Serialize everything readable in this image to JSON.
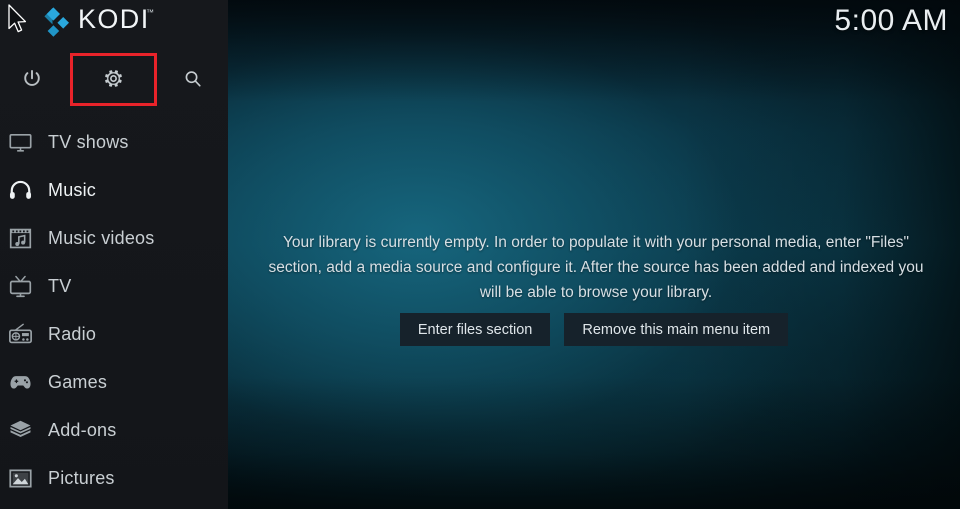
{
  "app": {
    "name": "Kodi",
    "logo_text": "KODI",
    "logo_tm": "™"
  },
  "header": {
    "clock": "5:00 AM"
  },
  "sidebar": {
    "top_actions": [
      {
        "name": "power",
        "icon": "power-icon",
        "highlighted": false
      },
      {
        "name": "settings",
        "icon": "gear-icon",
        "highlighted": true
      },
      {
        "name": "search",
        "icon": "search-icon",
        "highlighted": false
      }
    ],
    "highlight_color": "#e8232a",
    "items": [
      {
        "label": "TV shows",
        "icon": "tv-monitor-icon",
        "selected": false
      },
      {
        "label": "Music",
        "icon": "headphones-icon",
        "selected": true
      },
      {
        "label": "Music videos",
        "icon": "film-note-icon",
        "selected": false
      },
      {
        "label": "TV",
        "icon": "tv-antenna-icon",
        "selected": false
      },
      {
        "label": "Radio",
        "icon": "radio-icon",
        "selected": false
      },
      {
        "label": "Games",
        "icon": "gamepad-icon",
        "selected": false
      },
      {
        "label": "Add-ons",
        "icon": "package-box-icon",
        "selected": false
      },
      {
        "label": "Pictures",
        "icon": "picture-icon",
        "selected": false
      }
    ]
  },
  "main": {
    "empty_message": "Your library is currently empty. In order to populate it with your personal media, enter \"Files\" section, add a media source and configure it. After the source has been added and indexed you will be able to browse your library.",
    "buttons": [
      {
        "label": "Enter files section"
      },
      {
        "label": "Remove this main menu item"
      }
    ]
  },
  "colors": {
    "sidebar_bg": "#16181c",
    "content_teal": "#0c4153",
    "accent_blue": "#29a4d6",
    "highlight_red": "#e8232a",
    "button_bg": "#16222b"
  }
}
